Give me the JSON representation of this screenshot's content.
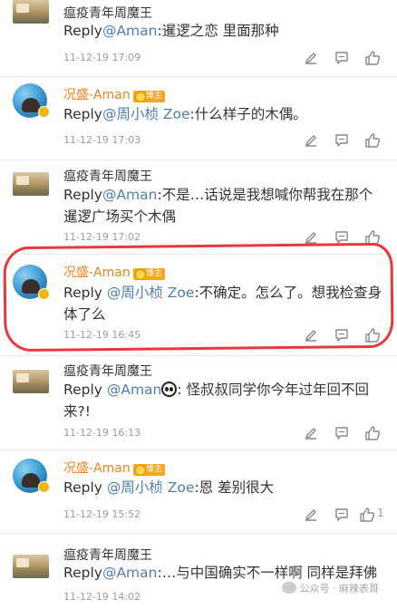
{
  "comments": [
    {
      "author": "瘟疫青年周魔王",
      "vip": false,
      "reply_prefix": "Reply",
      "mention": "@Aman",
      "text": ":暹逻之恋 里面那种",
      "timestamp": "11-12-19 17:09",
      "likes": ""
    },
    {
      "author": "况盛-Aman",
      "vip": true,
      "badge": "博主",
      "reply_prefix": "Reply",
      "mention": "@周小桢 Zoe",
      "text": ":什么样子的木偶。",
      "timestamp": "11-12-19 17:03",
      "likes": ""
    },
    {
      "author": "瘟疫青年周魔王",
      "vip": false,
      "reply_prefix": "Reply",
      "mention": "@Aman",
      "text": ":不是…话说是我想喊你帮我在那个暹逻广场买个木偶",
      "timestamp": "11-12-19 17:02",
      "likes": ""
    },
    {
      "author": "况盛-Aman",
      "vip": true,
      "badge": "博主",
      "reply_prefix": "Reply ",
      "mention": "@周小桢 Zoe",
      "text": ":不确定。怎么了。想我检查身体了么",
      "timestamp": "11-12-19 16:45",
      "likes": ""
    },
    {
      "author": "瘟疫青年周魔王",
      "vip": false,
      "reply_prefix": "Reply ",
      "mention": "@Aman",
      "text": ": 怪叔叔同学你今年过年回不回来?!",
      "timestamp": "11-12-19 16:13",
      "likes": ""
    },
    {
      "author": "况盛-Aman",
      "vip": true,
      "badge": "博主",
      "reply_prefix": "Reply ",
      "mention": "@周小桢 Zoe",
      "text": ":恩 差别很大",
      "timestamp": "11-12-19 15:52",
      "likes": "1"
    },
    {
      "author": "瘟疫青年周魔王",
      "vip": false,
      "reply_prefix": "Reply",
      "mention": "@Aman",
      "text": ":…与中国确实不一样啊 同样是拜佛",
      "timestamp": "11-12-19 14:02",
      "likes": ""
    }
  ],
  "watermark": "公众号 · 麻辣表哥",
  "colors": {
    "mention": "#507daf",
    "vip_name": "#f08020",
    "badge": "#f5a623",
    "highlight": "#e8383d",
    "meta": "#9b9b9b"
  },
  "icons": [
    "edit-icon",
    "comment-icon",
    "like-icon"
  ]
}
